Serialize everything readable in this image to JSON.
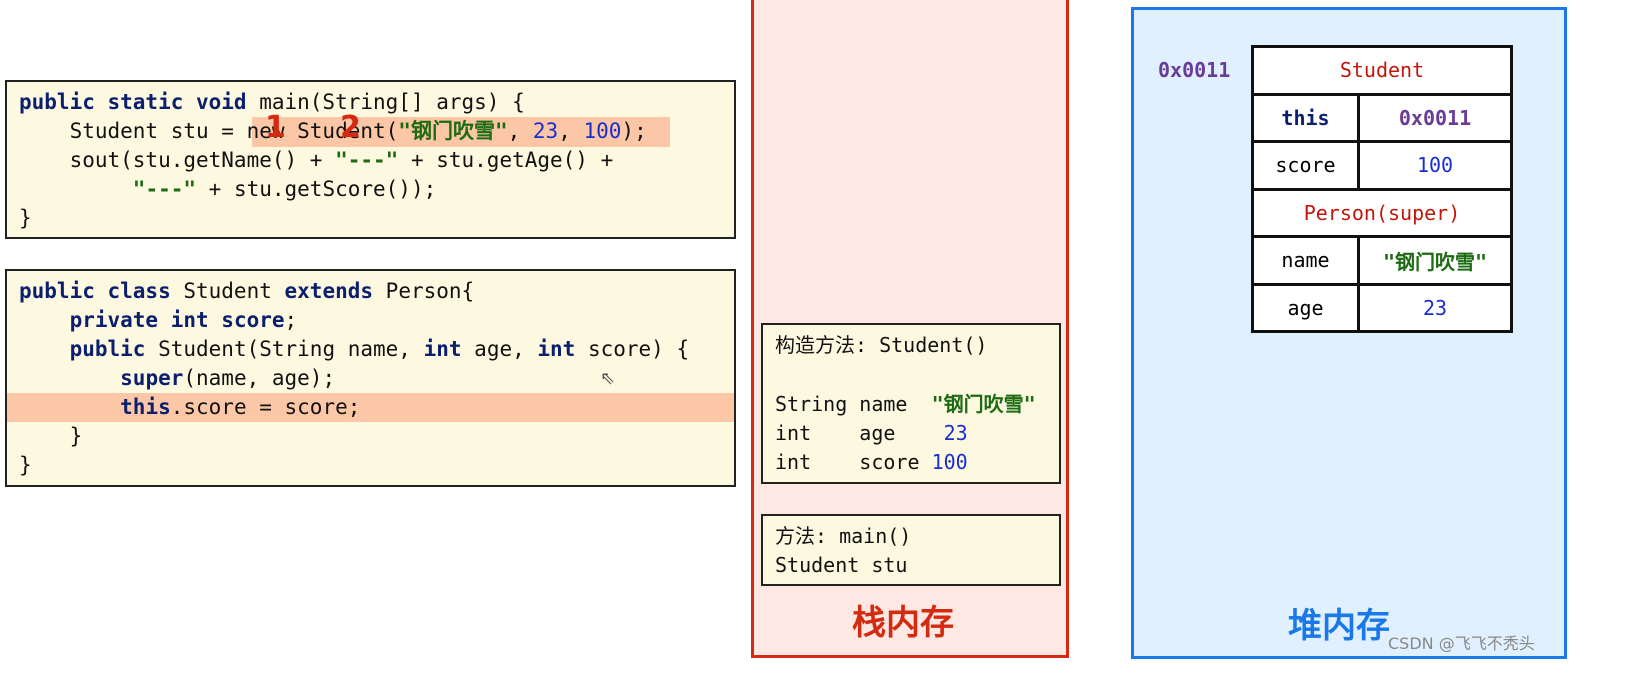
{
  "code_main": {
    "lines": [
      [
        {
          "t": "public static void",
          "c": "kw"
        },
        {
          "t": " main(String[] args) {",
          "c": ""
        }
      ],
      [
        {
          "t": "    Student stu = new Student(",
          "c": ""
        },
        {
          "t": "\"钢门吹雪\"",
          "c": "str"
        },
        {
          "t": ", ",
          "c": ""
        },
        {
          "t": "23",
          "c": "num"
        },
        {
          "t": ", ",
          "c": ""
        },
        {
          "t": "100",
          "c": "num"
        },
        {
          "t": ");",
          "c": ""
        }
      ],
      [
        {
          "t": "    sout(stu.getName() + ",
          "c": ""
        },
        {
          "t": "\"---\"",
          "c": "str"
        },
        {
          "t": " + stu.getAge() +",
          "c": ""
        }
      ],
      [
        {
          "t": "         ",
          "c": ""
        },
        {
          "t": "\"---\"",
          "c": "str"
        },
        {
          "t": " + stu.getScore());",
          "c": ""
        }
      ],
      [
        {
          "t": "}",
          "c": ""
        }
      ]
    ],
    "markers": [
      "1",
      "2"
    ]
  },
  "code_class": {
    "lines": [
      [
        {
          "t": "public class",
          "c": "kw"
        },
        {
          "t": " Student ",
          "c": ""
        },
        {
          "t": "extends",
          "c": "kw"
        },
        {
          "t": " Person{",
          "c": ""
        }
      ],
      [
        {
          "t": "    ",
          "c": ""
        },
        {
          "t": "private int score",
          "c": "kw"
        },
        {
          "t": ";",
          "c": ""
        }
      ],
      [
        {
          "t": "    ",
          "c": ""
        },
        {
          "t": "public",
          "c": "kw"
        },
        {
          "t": " Student(String name, ",
          "c": ""
        },
        {
          "t": "int",
          "c": "kw"
        },
        {
          "t": " age, ",
          "c": ""
        },
        {
          "t": "int",
          "c": "kw"
        },
        {
          "t": " score) {",
          "c": ""
        }
      ],
      [
        {
          "t": "        ",
          "c": ""
        },
        {
          "t": "super",
          "c": "kw"
        },
        {
          "t": "(name, age);",
          "c": ""
        }
      ],
      [
        {
          "t": "        ",
          "c": ""
        },
        {
          "t": "this",
          "c": "kw"
        },
        {
          "t": ".score = score;",
          "c": ""
        }
      ],
      [
        {
          "t": "    }",
          "c": ""
        }
      ],
      [
        {
          "t": "}",
          "c": ""
        }
      ]
    ]
  },
  "stack": {
    "label": "栈内存",
    "constructor_frame": {
      "title": "构造方法: Student()",
      "vars": [
        {
          "type": "String",
          "name": "name ",
          "value": "\"钢门吹雪\"",
          "c": "str"
        },
        {
          "type": "int   ",
          "name": "age  ",
          "value": " 23",
          "c": "num"
        },
        {
          "type": "int   ",
          "name": "score",
          "value": "100",
          "c": "num"
        }
      ]
    },
    "main_frame": {
      "title": "方法: main()",
      "var": "Student stu"
    }
  },
  "heap": {
    "label": "堆内存",
    "address": "0x0011",
    "object": {
      "class": "Student",
      "rows": [
        {
          "k": "this",
          "v": "0x0011"
        },
        {
          "k": "score",
          "v": "100"
        }
      ],
      "super": "Person(super)",
      "super_rows": [
        {
          "k": "name",
          "v": "\"钢门吹雪\""
        },
        {
          "k": "age",
          "v": "23"
        }
      ]
    }
  },
  "watermark": "CSDN @飞飞不秃头",
  "colors": {
    "stack_border": "#d32b10",
    "heap_border": "#1a78e8",
    "highlight": "#fbc7a6",
    "code_bg": "#fdf9e1"
  }
}
